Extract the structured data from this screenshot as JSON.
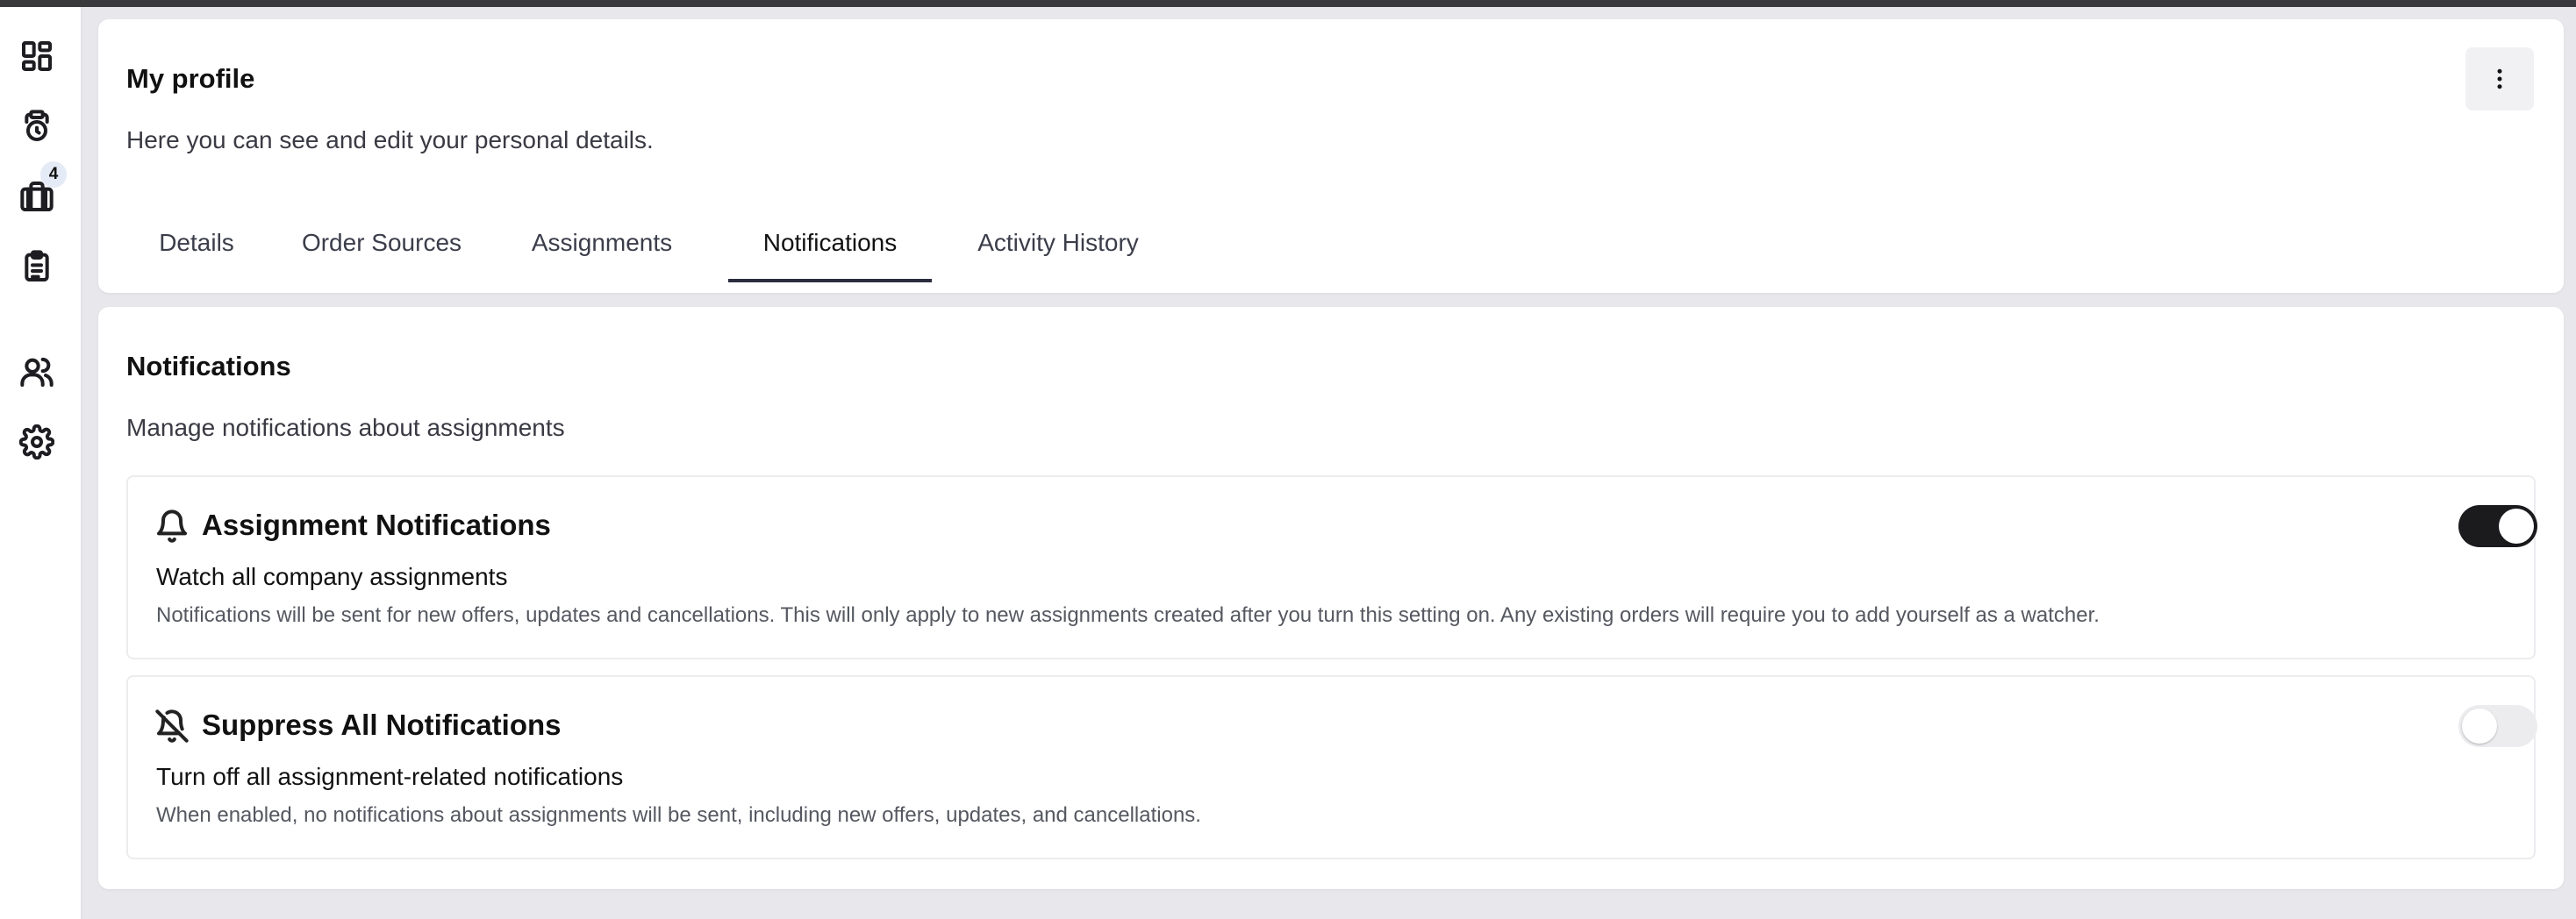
{
  "sidebar": {
    "items": [
      {
        "icon": "dashboard-icon"
      },
      {
        "icon": "schedule-icon"
      },
      {
        "icon": "assignments-icon",
        "badge": "4"
      },
      {
        "icon": "clipboard-icon"
      },
      {
        "icon": "users-icon"
      },
      {
        "icon": "gear-icon"
      }
    ]
  },
  "profile": {
    "title": "My profile",
    "subtitle": "Here you can see and edit your personal details.",
    "menu_icon": "more-vertical-icon",
    "tabs": [
      "Details",
      "Order Sources",
      "Assignments",
      "Notifications",
      "Activity History"
    ],
    "active_tab": "Notifications"
  },
  "notifications": {
    "title": "Notifications",
    "subtitle": "Manage notifications about assignments",
    "settings": [
      {
        "icon": "bell-icon",
        "title": "Assignment Notifications",
        "heading": "Watch all company assignments",
        "description": "Notifications will be sent for new offers, updates and cancellations. This will only apply to new assignments created after you turn this setting on. Any existing orders will require you to add yourself as a watcher.",
        "enabled": true
      },
      {
        "icon": "bell-off-icon",
        "title": "Suppress All Notifications",
        "heading": "Turn off all assignment-related notifications",
        "description": "When enabled, no notifications about assignments will be sent, including new offers, updates, and cancellations.",
        "enabled": false
      }
    ]
  },
  "colors": {
    "toggle_on": "#1b1b1e",
    "toggle_off": "#ececef",
    "active_tab_underline": "#2b2d3e",
    "page_background": "#e8e8ec"
  }
}
